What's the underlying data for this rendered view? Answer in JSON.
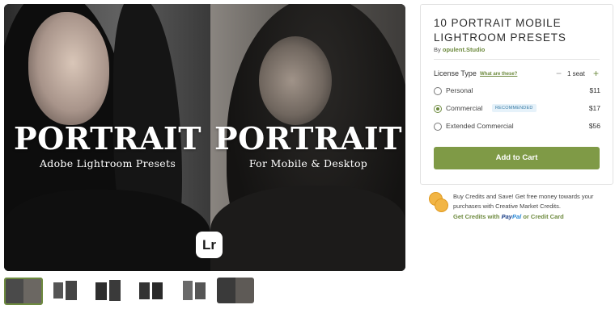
{
  "preview": {
    "left": {
      "title": "PORTRAIT",
      "subtitle": "Adobe Lightroom Presets"
    },
    "right": {
      "title": "PORTRAIT",
      "subtitle": "For Mobile & Desktop"
    },
    "badge": "Lr"
  },
  "thumbnails": {
    "count": 6,
    "active_index": 0
  },
  "product": {
    "title": "10 PORTRAIT MOBILE LIGHTROOM PRESETS",
    "by_prefix": "By",
    "store": "opulent.Studio"
  },
  "license": {
    "label": "License Type",
    "help_link": "What are these?",
    "seat_count": "1 seat",
    "minus": "−",
    "plus": "+",
    "options": [
      {
        "label": "Personal",
        "price": "$11",
        "selected": false
      },
      {
        "label": "Commercial",
        "price": "$17",
        "selected": true,
        "badge": "RECOMMENDED"
      },
      {
        "label": "Extended Commercial",
        "price": "$56",
        "selected": false
      }
    ]
  },
  "cart": {
    "button_label": "Add to Cart"
  },
  "credits": {
    "text": "Buy Credits and Save! Get free money towards your purchases with Creative Market Credits.",
    "link_prefix": "Get Credits with",
    "paypal_a": "Pay",
    "paypal_b": "Pal",
    "or_text": "or",
    "card_link": "Credit Card"
  },
  "colors": {
    "accent": "#7f9a46",
    "link": "#6d8a3e",
    "badge_bg": "#e6f2fa"
  }
}
